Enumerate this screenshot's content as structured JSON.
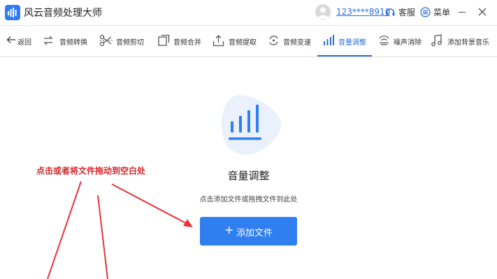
{
  "window": {
    "title": "风云音频处理大师",
    "user_phone": "123****8910",
    "service_label": "客服",
    "menu_label": "菜单"
  },
  "toolbar": {
    "items": [
      {
        "id": "back",
        "label": "返回",
        "icon": "arrow-left-icon"
      },
      {
        "id": "convert",
        "label": "音频转换",
        "icon": "swap-arrows-icon"
      },
      {
        "id": "cut",
        "label": "音频剪切",
        "icon": "scissors-icon"
      },
      {
        "id": "merge",
        "label": "音频合并",
        "icon": "merge-icon"
      },
      {
        "id": "extract",
        "label": "音频提取",
        "icon": "upload-tray-icon"
      },
      {
        "id": "speed",
        "label": "音频变速",
        "icon": "speed-cycle-icon"
      },
      {
        "id": "volume",
        "label": "音量调整",
        "icon": "volume-bars-icon",
        "active": true
      },
      {
        "id": "denoise",
        "label": "噪声消除",
        "icon": "denoise-wave-icon"
      },
      {
        "id": "bgm",
        "label": "添加背景音乐",
        "icon": "music-note-icon"
      }
    ]
  },
  "main": {
    "feature_title": "音量调整",
    "hint": "点击添加文件或拖拽文件到此处",
    "add_button_plus": "+",
    "add_button_label": "添加文件",
    "annotation": "点击或者将文件拖动到空白处"
  },
  "colors": {
    "accent": "#2f7ff0",
    "annotation": "#d7262b",
    "active_tab": "#2b6fd8"
  }
}
